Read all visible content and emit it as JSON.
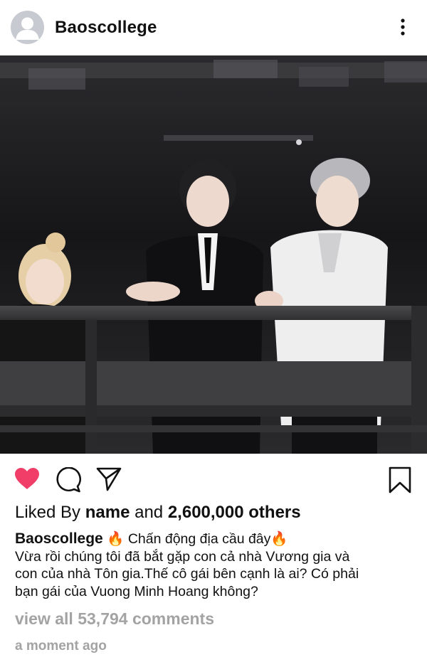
{
  "post": {
    "username": "Baoscollege",
    "photo_description": "Three people standing behind a dark railing at an event",
    "liked_by_prefix": "Liked By",
    "liked_by_name": "name",
    "liked_by_and": "and",
    "liked_by_count": "2,600,000 others",
    "caption_user": "Baoscollege",
    "caption_line1": " 🔥 Chấn động địa cầu đây🔥",
    "caption_line2": "Vừa rồi chúng tôi đã bắt gặp con cả nhà Vương gia và",
    "caption_line3": "con của nhà Tôn gia.Thế cô gái bên cạnh là ai? Có phải",
    "caption_line4": "bạn gái của Vuong Minh Hoang không?",
    "view_comments": "view all 53,794 comments",
    "timestamp": "a moment ago"
  },
  "icons": {
    "more": "more-options-icon",
    "like": "heart-icon",
    "comment": "comment-icon",
    "share": "send-icon",
    "save": "bookmark-icon"
  },
  "colors": {
    "like_active": "#f03e68",
    "muted_text": "#a3a3a3",
    "avatar_bg": "#c7cbd1"
  }
}
